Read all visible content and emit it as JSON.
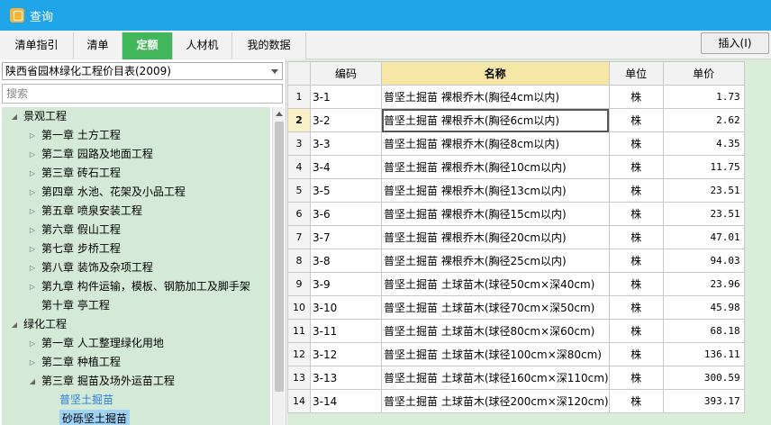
{
  "window": {
    "title": "查询"
  },
  "tabs": [
    {
      "label": "清单指引",
      "active": false
    },
    {
      "label": "清单",
      "active": false
    },
    {
      "label": "定额",
      "active": true
    },
    {
      "label": "人材机",
      "active": false
    },
    {
      "label": "我的数据",
      "active": false
    }
  ],
  "toolbar": {
    "insert_label": "插入(I)"
  },
  "left_panel": {
    "catalog": "陕西省园林绿化工程价目表(2009)",
    "search_placeholder": "搜索",
    "tree": [
      {
        "label": "景观工程",
        "level": 0,
        "state": "expanded"
      },
      {
        "label": "第一章  土方工程",
        "level": 1,
        "state": "collapsed"
      },
      {
        "label": "第二章  园路及地面工程",
        "level": 1,
        "state": "collapsed"
      },
      {
        "label": "第三章  砖石工程",
        "level": 1,
        "state": "collapsed"
      },
      {
        "label": "第四章  水池、花架及小品工程",
        "level": 1,
        "state": "collapsed"
      },
      {
        "label": "第五章  喷泉安装工程",
        "level": 1,
        "state": "collapsed"
      },
      {
        "label": "第六章  假山工程",
        "level": 1,
        "state": "collapsed"
      },
      {
        "label": "第七章  步桥工程",
        "level": 1,
        "state": "collapsed"
      },
      {
        "label": "第八章  装饰及杂项工程",
        "level": 1,
        "state": "collapsed"
      },
      {
        "label": "第九章  构件运输，模板、钢筋加工及脚手架",
        "level": 1,
        "state": "collapsed"
      },
      {
        "label": "第十章  亭工程",
        "level": 1,
        "state": "leaf"
      },
      {
        "label": "绿化工程",
        "level": 0,
        "state": "expanded"
      },
      {
        "label": "第一章  人工整理绿化用地",
        "level": 1,
        "state": "collapsed"
      },
      {
        "label": "第二章  种植工程",
        "level": 1,
        "state": "collapsed"
      },
      {
        "label": "第三章  掘苗及场外运苗工程",
        "level": 1,
        "state": "expanded"
      },
      {
        "label": "普坚土掘苗",
        "level": 2,
        "state": "selected"
      },
      {
        "label": "砂砾坚土掘苗",
        "level": 2,
        "state": "highlight"
      }
    ]
  },
  "table": {
    "headers": {
      "code": "编码",
      "name": "名称",
      "unit": "单位",
      "price": "单价"
    },
    "selected_row": 2,
    "rows": [
      {
        "num": "1",
        "code": "3-1",
        "name": "普坚土掘苗  裸根乔木(胸径4cm以内)",
        "unit": "株",
        "price": "1.73"
      },
      {
        "num": "2",
        "code": "3-2",
        "name": "普坚土掘苗  裸根乔木(胸径6cm以内)",
        "unit": "株",
        "price": "2.62"
      },
      {
        "num": "3",
        "code": "3-3",
        "name": "普坚土掘苗  裸根乔木(胸径8cm以内)",
        "unit": "株",
        "price": "4.35"
      },
      {
        "num": "4",
        "code": "3-4",
        "name": "普坚土掘苗  裸根乔木(胸径10cm以内)",
        "unit": "株",
        "price": "11.75"
      },
      {
        "num": "5",
        "code": "3-5",
        "name": "普坚土掘苗  裸根乔木(胸径13cm以内)",
        "unit": "株",
        "price": "23.51"
      },
      {
        "num": "6",
        "code": "3-6",
        "name": "普坚土掘苗  裸根乔木(胸径15cm以内)",
        "unit": "株",
        "price": "23.51"
      },
      {
        "num": "7",
        "code": "3-7",
        "name": "普坚土掘苗  裸根乔木(胸径20cm以内)",
        "unit": "株",
        "price": "47.01"
      },
      {
        "num": "8",
        "code": "3-8",
        "name": "普坚土掘苗  裸根乔木(胸径25cm以内)",
        "unit": "株",
        "price": "94.03"
      },
      {
        "num": "9",
        "code": "3-9",
        "name": "普坚土掘苗  土球苗木(球径50cm×深40cm)",
        "unit": "株",
        "price": "23.96"
      },
      {
        "num": "10",
        "code": "3-10",
        "name": "普坚土掘苗  土球苗木(球径70cm×深50cm)",
        "unit": "株",
        "price": "45.98"
      },
      {
        "num": "11",
        "code": "3-11",
        "name": "普坚土掘苗  土球苗木(球径80cm×深60cm)",
        "unit": "株",
        "price": "68.18"
      },
      {
        "num": "12",
        "code": "3-12",
        "name": "普坚土掘苗  土球苗木(球径100cm×深80cm)",
        "unit": "株",
        "price": "136.11"
      },
      {
        "num": "13",
        "code": "3-13",
        "name": "普坚土掘苗  土球苗木(球径160cm×深110cm)",
        "unit": "株",
        "price": "300.59"
      },
      {
        "num": "14",
        "code": "3-14",
        "name": "普坚土掘苗  土球苗木(球径200cm×深120cm)",
        "unit": "株",
        "price": "393.17"
      }
    ]
  },
  "colors": {
    "title_bar": "#1fa5e8",
    "active_tab": "#42b65a",
    "tree_background": "#d5ead6",
    "header_highlight": "#f7e7a6",
    "tree_highlight": "#9fd3f6"
  }
}
